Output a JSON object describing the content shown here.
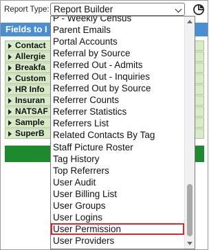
{
  "report_type": {
    "label": "Report Type:",
    "selected": "Report Builder"
  },
  "fields_header": "Fields to I",
  "field_groups": [
    {
      "label": "Contact"
    },
    {
      "label": "Allergie"
    },
    {
      "label": "Breakfa"
    },
    {
      "label": "Custom"
    },
    {
      "label": "HR Info"
    },
    {
      "label": "Insuran"
    },
    {
      "label": "NATSAF"
    },
    {
      "label": "Sample"
    },
    {
      "label": "SuperB"
    }
  ],
  "dropdown": {
    "options": [
      {
        "label": "P - Weekly Census"
      },
      {
        "label": "Parent Emails"
      },
      {
        "label": "Portal Accounts"
      },
      {
        "label": "Referral by Source"
      },
      {
        "label": "Referred Out - Admits"
      },
      {
        "label": "Referred Out - Inquiries"
      },
      {
        "label": "Referred Out by Source"
      },
      {
        "label": "Referrer Counts"
      },
      {
        "label": "Referrer Statistics"
      },
      {
        "label": "Referrers List"
      },
      {
        "label": "Related Contacts By Tag"
      },
      {
        "label": "Staff Picture Roster"
      },
      {
        "label": "Tag History"
      },
      {
        "label": "Top Referrers"
      },
      {
        "label": "User Audit"
      },
      {
        "label": "User Billing List"
      },
      {
        "label": "User Groups"
      },
      {
        "label": "User Logins"
      },
      {
        "label": "User Permission"
      },
      {
        "label": "User Providers"
      }
    ],
    "highlighted": "User Permission"
  },
  "colors": {
    "header_blue": "#4a8fd4",
    "field_green": "#d8ebc8",
    "bar_green": "#1e8a2e",
    "highlight_red": "#e0262a"
  }
}
